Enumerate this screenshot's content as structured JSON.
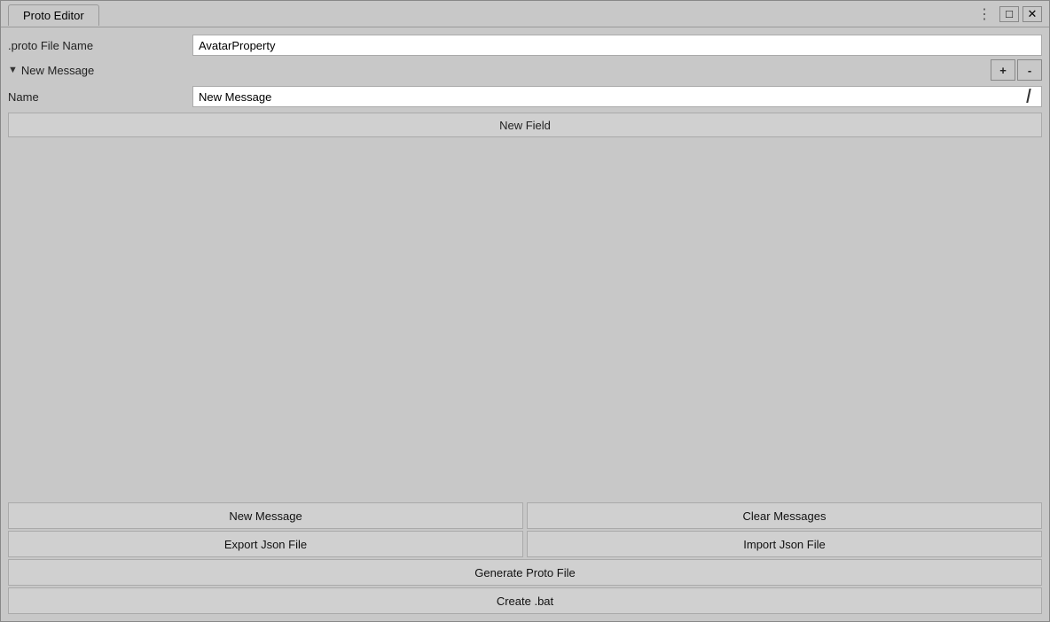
{
  "window": {
    "title": "Proto Editor"
  },
  "titleBar": {
    "tabLabel": "Proto Editor",
    "dotsIcon": "⋮",
    "maximizeLabel": "□",
    "closeLabel": "✕"
  },
  "form": {
    "fileNameLabel": ".proto File Name",
    "fileNameValue": "AvatarProperty",
    "messageLabel": "New Message",
    "triangleIcon": "▼",
    "nameLabel": "Name",
    "nameValue": "New Message",
    "newFieldLabel": "New Field"
  },
  "buttons": {
    "newMessageLabel": "New Message",
    "clearMessagesLabel": "Clear Messages",
    "exportJsonLabel": "Export Json File",
    "importJsonLabel": "Import Json File",
    "generateProtoLabel": "Generate Proto File",
    "createBatLabel": "Create .bat",
    "plusLabel": "+",
    "minusLabel": "-"
  }
}
